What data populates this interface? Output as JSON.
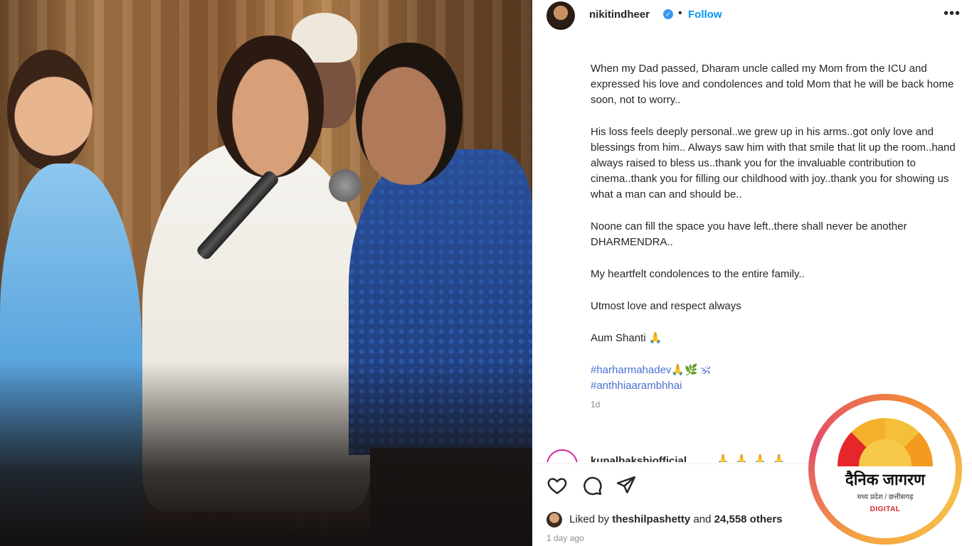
{
  "post": {
    "username": "nikitindheer",
    "follow_label": "Follow",
    "separator": "•",
    "more_label": "•••",
    "caption_paragraphs": [
      "When my Dad passed, Dharam uncle called my Mom from the ICU and expressed his love and condolences and told Mom that he will be back home soon, not to worry..",
      "His loss feels deeply personal..we grew up in his arms..got only love and blessings from him.. Always saw him with that smile that lit up the room..hand always raised to bless us..thank you for the invaluable contribution to cinema..thank you for filling our childhood with joy..thank you for showing us what a man can and should be..",
      "Noone can fill the space you have left..there shall never be another DHARMENDRA..",
      "My heartfelt condolences to the entire family..",
      "Utmost love and respect always",
      "Aum Shanti 🙏"
    ],
    "hashtags": [
      "#harharmahadev🙏🌿 🕉",
      "#anthhiaarambhhai"
    ],
    "time": "1d",
    "comment_peek": {
      "username": "kunalbakshiofficial",
      "emoji": "🙏🙏🙏🙏"
    },
    "likes": {
      "prefix": "Liked by",
      "user": "theshilpashetty",
      "middle": "and",
      "count": "24,558 others"
    },
    "posted": "1 day ago"
  },
  "watermark": {
    "title": "दैनिक जागरण",
    "subtitle": "मध्य प्रदेश / छत्तीसगढ़",
    "label": "DIGITAL"
  },
  "colors": {
    "follow": "#0095f6",
    "hashtag": "#4a6fd1",
    "verified": "#3897f0",
    "digital_label": "#d3262c"
  },
  "icons": [
    "heart-icon",
    "comment-icon",
    "share-icon",
    "bookmark-icon",
    "verified-badge-icon",
    "more-options-icon"
  ]
}
